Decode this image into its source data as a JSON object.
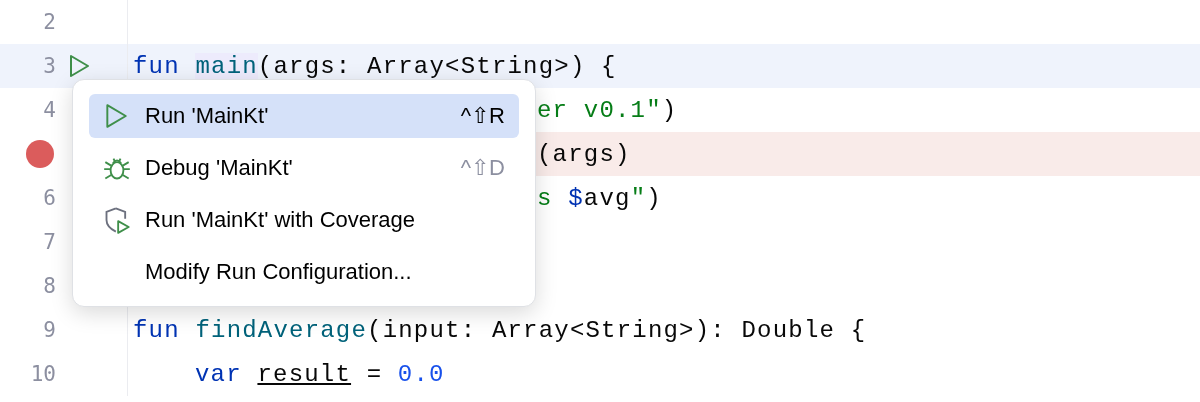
{
  "editor": {
    "lines": [
      {
        "number": "2",
        "current": false,
        "breakpoint": false,
        "runnable": false
      },
      {
        "number": "3",
        "kind": "code",
        "current": true,
        "breakpoint": false,
        "runnable": true,
        "tokens": [
          {
            "text": "fun ",
            "kind": "keyword"
          },
          {
            "text": "main",
            "kind": "function-highlighted"
          },
          {
            "text": "(args: Array<String>) {",
            "kind": "plain"
          }
        ]
      },
      {
        "number": "4",
        "kind": "fragment",
        "current": false,
        "breakpoint": false,
        "runnable": false,
        "tokens": [
          {
            "text": "er v0.1\"",
            "kind": "string"
          },
          {
            "text": ")",
            "kind": "plain"
          }
        ]
      },
      {
        "kind": "fragment",
        "current": false,
        "breakpoint": true,
        "runnable": false,
        "tokens": [
          {
            "text": "(args)",
            "kind": "plain"
          }
        ]
      },
      {
        "number": "6",
        "kind": "fragment",
        "current": false,
        "breakpoint": false,
        "runnable": false,
        "tokens": [
          {
            "text": "s ",
            "kind": "string"
          },
          {
            "text": "$",
            "kind": "keyword"
          },
          {
            "text": "avg",
            "kind": "plain"
          },
          {
            "text": "\"",
            "kind": "string"
          },
          {
            "text": ")",
            "kind": "plain"
          }
        ]
      },
      {
        "number": "7",
        "current": false,
        "breakpoint": false,
        "runnable": false
      },
      {
        "number": "8",
        "current": false,
        "breakpoint": false,
        "runnable": false
      },
      {
        "number": "9",
        "kind": "code",
        "current": false,
        "breakpoint": false,
        "runnable": false,
        "tokens": [
          {
            "text": "fun ",
            "kind": "keyword"
          },
          {
            "text": "findAverage",
            "kind": "function"
          },
          {
            "text": "(input: Array<String>): Double {",
            "kind": "plain"
          }
        ]
      },
      {
        "number": "10",
        "kind": "nested",
        "current": false,
        "breakpoint": false,
        "runnable": false,
        "tokens": [
          {
            "text": "var ",
            "kind": "keyword"
          },
          {
            "text": "result",
            "kind": "underlined"
          },
          {
            "text": " = ",
            "kind": "plain"
          },
          {
            "text": "0.0",
            "kind": "number"
          }
        ]
      }
    ]
  },
  "popup": {
    "items": [
      {
        "kind": "run",
        "label": "Run 'MainKt'",
        "shortcut": "^⇧R",
        "selected": true
      },
      {
        "kind": "debug",
        "label": "Debug 'MainKt'",
        "shortcut": "^⇧D",
        "selected": false
      },
      {
        "kind": "coverage",
        "label": "Run 'MainKt' with Coverage",
        "selected": false
      },
      {
        "kind": "plain",
        "label": "Modify Run Configuration...",
        "selected": false
      }
    ]
  }
}
